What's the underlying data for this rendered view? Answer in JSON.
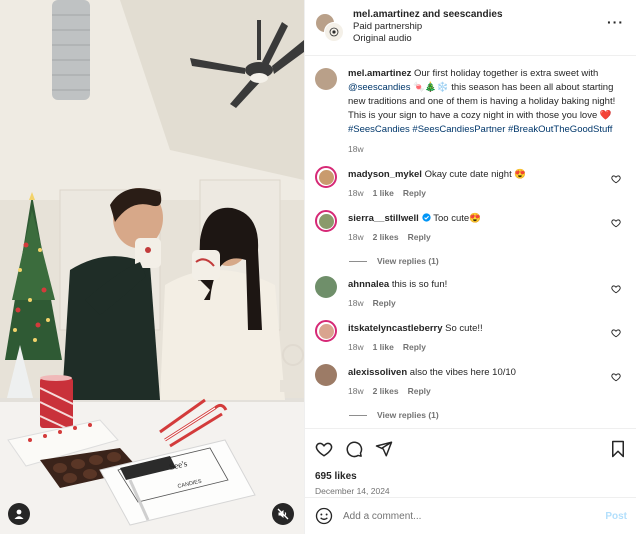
{
  "header": {
    "names": "mel.amartinez and seescandies",
    "partnership": "Paid partnership",
    "audio": "Original audio",
    "more_icon": "more-horizontal-icon"
  },
  "caption": {
    "username": "mel.amartinez",
    "text_1": " Our first holiday together is extra sweet with ",
    "mention": "@seescandies",
    "text_2": " 🍬🎄❄️ this season has been all about starting new traditions and one of them is having a holiday baking night! This is your sign to have a cozy night in with those you love ❤️ ",
    "hashtags": "#SeesCandies #SeesCandiesPartner #BreakOutTheGoodStuff",
    "time": "18w"
  },
  "comments": [
    {
      "username": "madyson_mykel",
      "text": " Okay cute date night 😍",
      "time": "18w",
      "likes": "1 like",
      "reply": "Reply",
      "ring": true,
      "avatar_color": "#c99b6e",
      "verified": false,
      "view_replies": ""
    },
    {
      "username": "sierra__stillwell",
      "text": " Too cute😍",
      "time": "18w",
      "likes": "2 likes",
      "reply": "Reply",
      "ring": true,
      "avatar_color": "#8a9a6b",
      "verified": true,
      "view_replies": "View replies (1)"
    },
    {
      "username": "ahnnalea",
      "text": " this is so fun!",
      "time": "18w",
      "likes": "",
      "reply": "Reply",
      "ring": false,
      "avatar_color": "#6f8f6a",
      "verified": false,
      "view_replies": ""
    },
    {
      "username": "itskatelyncastleberry",
      "text": " So cute!!",
      "time": "18w",
      "likes": "1 like",
      "reply": "Reply",
      "ring": true,
      "avatar_color": "#d9a48f",
      "verified": false,
      "view_replies": ""
    },
    {
      "username": "alexissoliven",
      "text": " also the vibes here 10/10",
      "time": "18w",
      "likes": "2 likes",
      "reply": "Reply",
      "ring": false,
      "avatar_color": "#9c7b66",
      "verified": false,
      "view_replies": "View replies (1)"
    }
  ],
  "actions": {
    "like_icon": "heart-icon",
    "comment_icon": "comment-icon",
    "share_icon": "share-icon",
    "save_icon": "bookmark-icon",
    "likes": "695 likes",
    "date": "December 14, 2024"
  },
  "add_comment": {
    "placeholder": "Add a comment...",
    "post": "Post"
  },
  "media": {
    "box_brand": "See's",
    "box_label": "CANDIES"
  }
}
